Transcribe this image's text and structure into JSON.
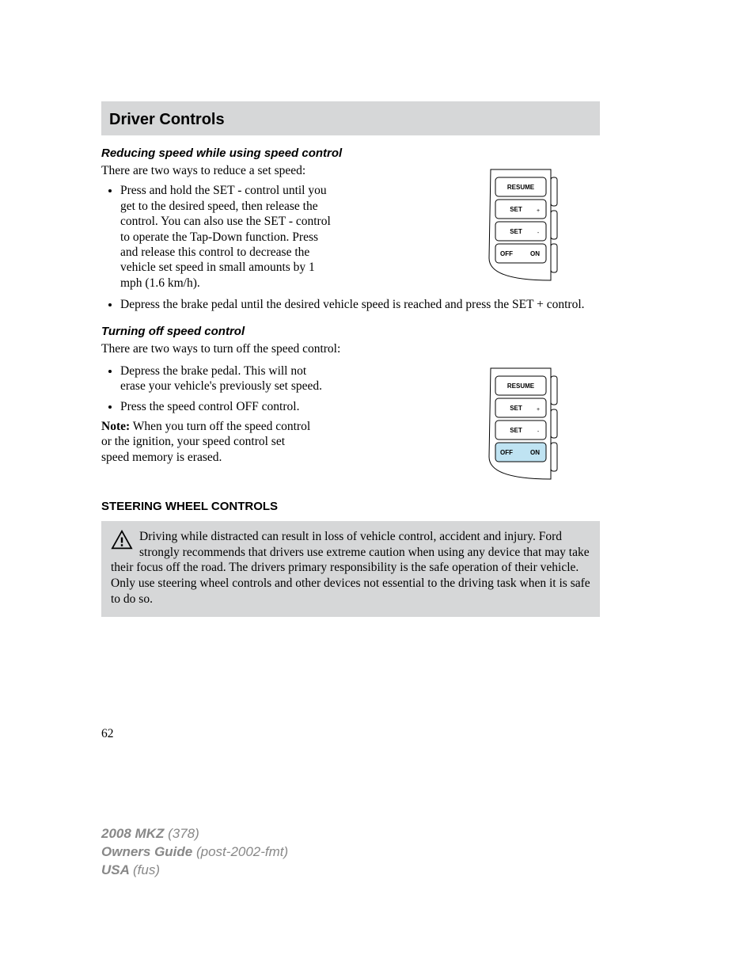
{
  "header": {
    "title": "Driver Controls"
  },
  "sec1": {
    "heading": "Reducing speed while using speed control",
    "intro": "There are two ways to reduce a set speed:",
    "b1": "Press and hold the SET - control until you get to the desired speed, then release the control. You can also use the SET - control to operate the Tap-Down function. Press and release this control to decrease the vehicle set speed in small amounts by 1 mph (1.6 km/h).",
    "b2": "Depress the brake pedal until the desired vehicle speed is reached and press the SET + control."
  },
  "sec2": {
    "heading": "Turning off speed control",
    "intro": "There are two ways to turn off the speed control:",
    "b1": "Depress the brake pedal. This will not erase your vehicle's previously set speed.",
    "b2": "Press the speed control OFF control.",
    "note_label": "Note:",
    "note_text": " When you turn off the speed control or the ignition, your speed control set speed memory is erased."
  },
  "sec3": {
    "heading": "STEERING WHEEL CONTROLS",
    "warning": "Driving while distracted can result in loss of vehicle control, accident and injury. Ford strongly recommends that drivers use extreme caution when using any device that may take their focus off the road. The drivers primary responsibility is the safe operation of their vehicle. Only use steering wheel controls and other devices not essential to the driving task when it is safe to do so."
  },
  "controls": {
    "btn1": "RESUME",
    "btn2": "SET",
    "btn2_sign": "+",
    "btn3": "SET",
    "btn3_sign": "-",
    "btn4_left": "OFF",
    "btn4_right": "ON",
    "highlight_row": 0
  },
  "controls2": {
    "btn1": "RESUME",
    "btn2": "SET",
    "btn2_sign": "+",
    "btn3": "SET",
    "btn3_sign": "-",
    "btn4_left": "OFF",
    "btn4_right": "ON",
    "highlight_row": 4
  },
  "page_number": "62",
  "footer": {
    "l1a": "2008 MKZ ",
    "l1b": "(378)",
    "l2a": "Owners Guide ",
    "l2b": "(post-2002-fmt)",
    "l3a": "USA ",
    "l3b": "(fus)"
  }
}
